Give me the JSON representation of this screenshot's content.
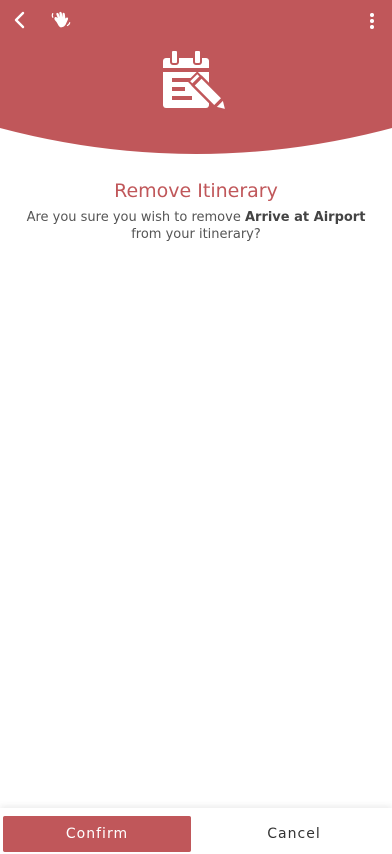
{
  "colors": {
    "brand": "#c0575a",
    "text": "#555555",
    "background": "#ffffff"
  },
  "header": {
    "back_icon": "chevron-left-icon",
    "wave_icon": "waving-hand-icon",
    "more_icon": "more-vertical-icon",
    "hero_icon": "calendar-edit-icon"
  },
  "dialog": {
    "title": "Remove Itinerary",
    "message_prefix": "Are you sure you wish to remove ",
    "item_name": "Arrive at Airport",
    "message_suffix": " from your itinerary?"
  },
  "footer": {
    "confirm_label": "Confirm",
    "cancel_label": "Cancel"
  }
}
